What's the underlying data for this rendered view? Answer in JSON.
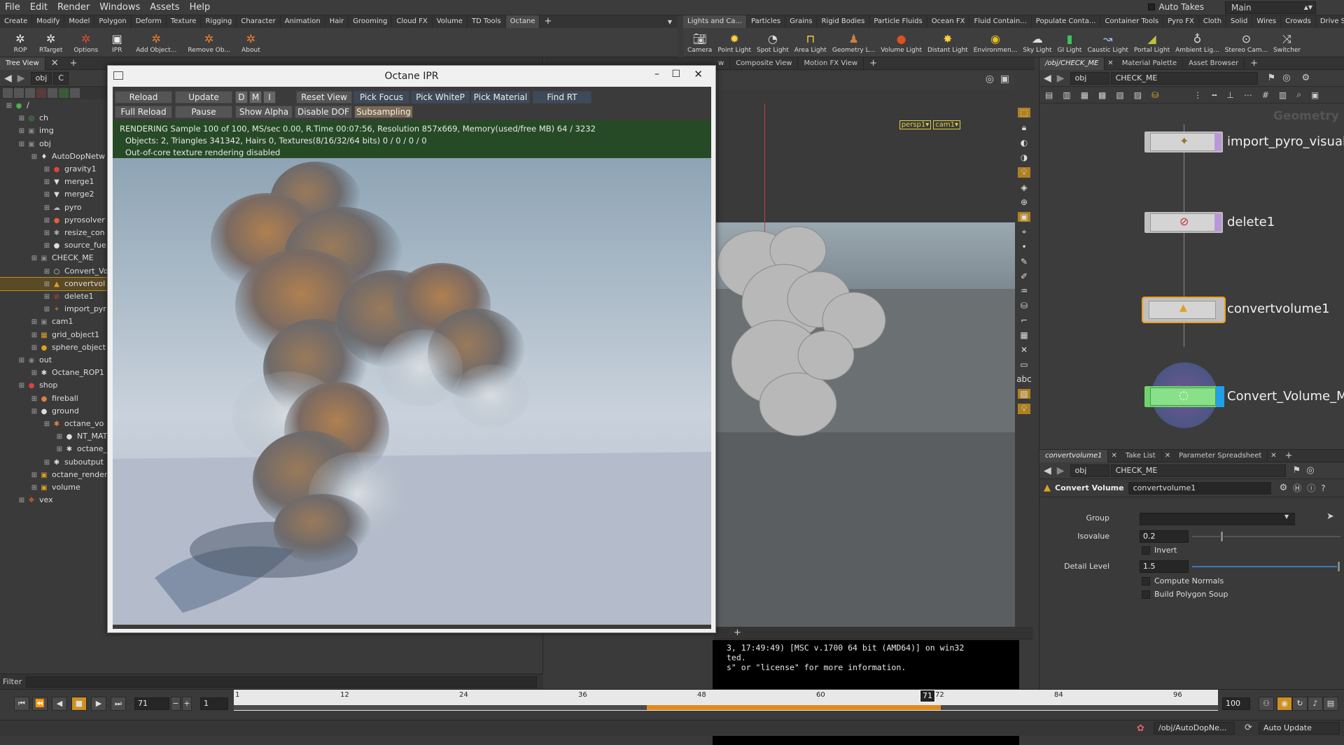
{
  "menubar": {
    "items": [
      "File",
      "Edit",
      "Render",
      "Windows",
      "Assets",
      "Help"
    ],
    "auto_takes": "Auto Takes",
    "desktop": "Main"
  },
  "shelf_left": {
    "tabs": [
      "Create",
      "Modify",
      "Model",
      "Polygon",
      "Deform",
      "Texture",
      "Rigging",
      "Character",
      "Animation",
      "Hair",
      "Grooming",
      "Cloud FX",
      "Volume",
      "TD Tools",
      "Octane"
    ],
    "tools": [
      "ROP",
      "RTarget",
      "Options",
      "IPR",
      "Add Object...",
      "Remove Ob...",
      "About"
    ]
  },
  "shelf_right": {
    "tabs": [
      "Lights and Ca...",
      "Particles",
      "Grains",
      "Rigid Bodies",
      "Particle Fluids",
      "Ocean FX",
      "Fluid Contain...",
      "Populate Conta...",
      "Container Tools",
      "Pyro FX",
      "Cloth",
      "Solid",
      "Wires",
      "Crowds",
      "Drive Simulati..."
    ],
    "tools": [
      "Camera",
      "Point Light",
      "Spot Light",
      "Area Light",
      "Geometry L...",
      "Volume Light",
      "Distant Light",
      "Environmen...",
      "Sky Light",
      "GI Light",
      "Caustic Light",
      "Portal Light",
      "Ambient Lig...",
      "Stereo Cam...",
      "Switcher"
    ]
  },
  "tree": {
    "tab": "Tree View",
    "path": "obj",
    "path2": "C",
    "filter_label": "Filter",
    "rows": [
      {
        "label": "/",
        "depth": 0,
        "icon": "●"
      },
      {
        "label": "ch",
        "depth": 1,
        "icon": "◎"
      },
      {
        "label": "img",
        "depth": 1,
        "icon": "▣"
      },
      {
        "label": "obj",
        "depth": 1,
        "icon": "▣"
      },
      {
        "label": "AutoDopNetw",
        "depth": 2,
        "icon": "♦"
      },
      {
        "label": "gravity1",
        "depth": 3,
        "icon": "●"
      },
      {
        "label": "merge1",
        "depth": 3,
        "icon": "▼"
      },
      {
        "label": "merge2",
        "depth": 3,
        "icon": "▼"
      },
      {
        "label": "pyro",
        "depth": 3,
        "icon": "☁"
      },
      {
        "label": "pyrosolver",
        "depth": 3,
        "icon": "●"
      },
      {
        "label": "resize_con",
        "depth": 3,
        "icon": "✱"
      },
      {
        "label": "source_fue",
        "depth": 3,
        "icon": "●"
      },
      {
        "label": "CHECK_ME",
        "depth": 2,
        "icon": "▣"
      },
      {
        "label": "Convert_Vo",
        "depth": 3,
        "icon": "○"
      },
      {
        "label": "convertvol",
        "depth": 3,
        "icon": "▲"
      },
      {
        "label": "delete1",
        "depth": 3,
        "icon": "⊘"
      },
      {
        "label": "import_pyr",
        "depth": 3,
        "icon": "✦"
      },
      {
        "label": "cam1",
        "depth": 2,
        "icon": "▣"
      },
      {
        "label": "grid_object1",
        "depth": 2,
        "icon": "▦"
      },
      {
        "label": "sphere_object",
        "depth": 2,
        "icon": "●"
      },
      {
        "label": "out",
        "depth": 1,
        "icon": "◉"
      },
      {
        "label": "Octane_ROP1",
        "depth": 2,
        "icon": "✱"
      },
      {
        "label": "shop",
        "depth": 1,
        "icon": "●"
      },
      {
        "label": "fireball",
        "depth": 2,
        "icon": "●"
      },
      {
        "label": "ground",
        "depth": 2,
        "icon": "●"
      },
      {
        "label": "octane_vo",
        "depth": 3,
        "icon": "✱"
      },
      {
        "label": "NT_MAT",
        "depth": 4,
        "icon": "●"
      },
      {
        "label": "octane_",
        "depth": 4,
        "icon": "✱"
      },
      {
        "label": "suboutput",
        "depth": 3,
        "icon": "✱"
      },
      {
        "label": "octane_render",
        "depth": 2,
        "icon": "▣"
      },
      {
        "label": "volume",
        "depth": 2,
        "icon": "▣"
      },
      {
        "label": "vex",
        "depth": 1,
        "icon": "❖"
      }
    ]
  },
  "ipr": {
    "title": "Octane IPR",
    "buttons_row1": [
      "Reload",
      "Update",
      "D",
      "M",
      "I",
      "Reset View",
      "Pick Focus",
      "Pick WhiteP",
      "Pick Material",
      "Find RT"
    ],
    "buttons_row2": [
      "Full Reload",
      "Pause",
      "Show Alpha",
      "Disable DOF",
      "Subsampling"
    ],
    "status_line1": "RENDERING Sample 100 of 100,  MS/sec 0.00,  R.Time 00:07:56,  Resolution 857x669,  Memory(used/free MB) 64 / 3232",
    "status_line2": "Objects: 2,  Triangles 341342,  Hairs 0,  Textures(8/16/32/64 bits) 0 / 0 / 0 / 0",
    "status_line3": "Out-of-core texture rendering disabled"
  },
  "viewport": {
    "tabs": [
      "w",
      "Composite View",
      "Motion FX View"
    ],
    "camera_persp": "persp1▾",
    "camera_cam": "cam1▾"
  },
  "console": {
    "line1": "3, 17:49:49) [MSC v.1700 64 bit (AMD64)] on win32",
    "line2": "ted.",
    "line3": "s\" or \"license\" for more information."
  },
  "network": {
    "tabs": [
      "/obj/CHECK_ME",
      "Material Palette",
      "Asset Browser"
    ],
    "path1": "obj",
    "path2": "CHECK_ME",
    "corner_label": "Geometry",
    "nodes": [
      {
        "name": "import_pyro_visualiz",
        "color": "#c0c0c0"
      },
      {
        "name": "delete1",
        "color": "#c0c0c0"
      },
      {
        "name": "convertvolume1",
        "color": "#c0c0c0"
      },
      {
        "name": "Convert_Volume_Me",
        "color": "#6fd36f"
      }
    ]
  },
  "params": {
    "tabs": [
      "convertvolume1",
      "Take List",
      "Parameter Spreadsheet"
    ],
    "path1": "obj",
    "path2": "CHECK_ME",
    "node_type": "Convert Volume",
    "node_name": "convertvolume1",
    "group_label": "Group",
    "group_value": "",
    "isovalue_label": "Isovalue",
    "isovalue": "0.2",
    "isovalue_fraction": 0.2,
    "invert_label": "Invert",
    "detail_label": "Detail Level",
    "detail": "1.5",
    "detail_fraction": 1.0,
    "compute_normals": "Compute Normals",
    "build_soup": "Build Polygon Soup"
  },
  "timeline": {
    "current_frame": "71",
    "step": "1",
    "end_frame": "100",
    "marker_frame": "71",
    "ticks": [
      "1",
      "12",
      "24",
      "36",
      "48",
      "60",
      "72",
      "84",
      "96"
    ]
  },
  "statusbar": {
    "path": "/obj/AutoDopNe...",
    "update_mode": "Auto Update"
  },
  "colors": {
    "accent": "#f0a020",
    "status_green": "#274a26",
    "selection": "#b8941c"
  }
}
